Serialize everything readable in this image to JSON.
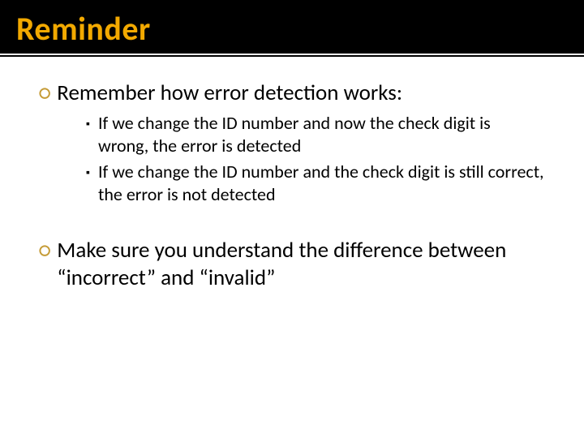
{
  "title": "Reminder",
  "points": [
    {
      "text": "Remember how error detection works:",
      "sub": [
        "If we change the ID number and now the check digit is wrong, the error is detected",
        "If we change the ID number and the check digit is still correct, the error is not detected"
      ]
    },
    {
      "text": "Make sure you understand the difference between “incorrect” and “invalid”",
      "sub": []
    }
  ],
  "bullets": {
    "lvl1": "○",
    "lvl2": "▪"
  }
}
